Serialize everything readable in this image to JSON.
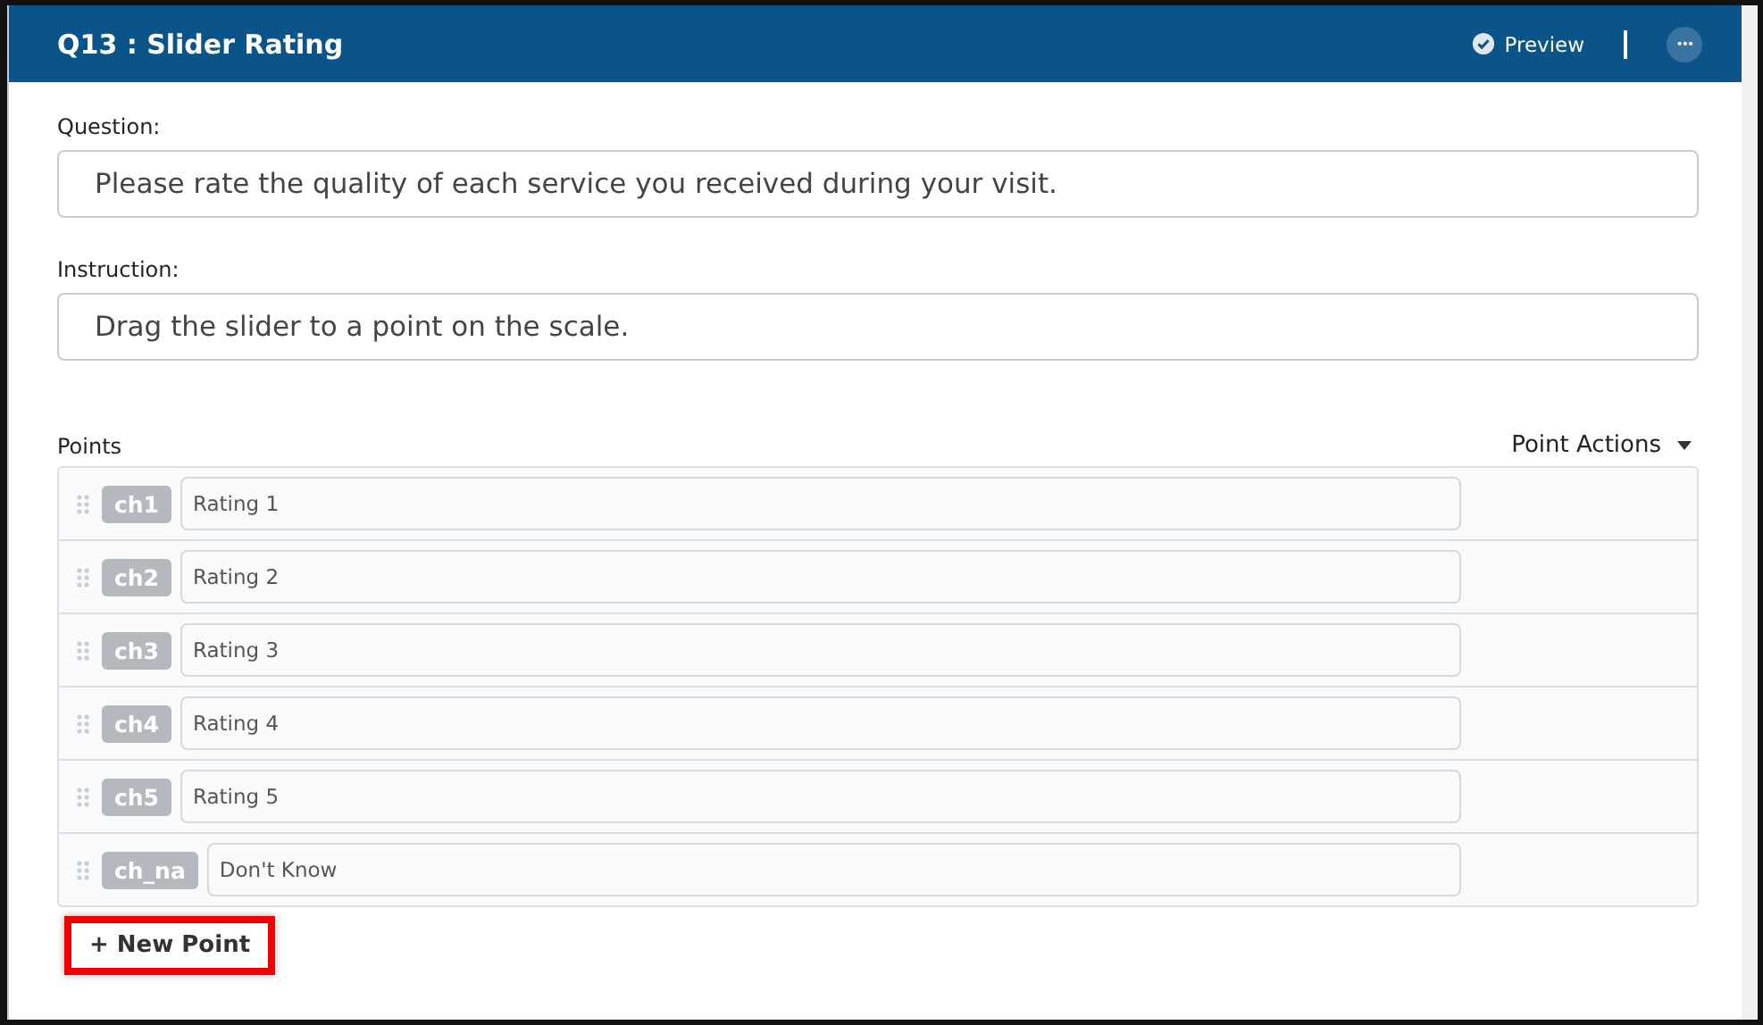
{
  "header": {
    "title": "Q13 : Slider Rating",
    "preview": "Preview",
    "more": "•••"
  },
  "question": {
    "label": "Question:",
    "value": "Please rate the quality of each service you received during your visit."
  },
  "instruction": {
    "label": "Instruction:",
    "value": "Drag the slider to a point on the scale."
  },
  "points": {
    "label": "Points",
    "actions": "Point Actions",
    "items": [
      {
        "code": "ch1",
        "value": "Rating 1"
      },
      {
        "code": "ch2",
        "value": "Rating 2"
      },
      {
        "code": "ch3",
        "value": "Rating 3"
      },
      {
        "code": "ch4",
        "value": "Rating 4"
      },
      {
        "code": "ch5",
        "value": "Rating 5"
      },
      {
        "code": "ch_na",
        "value": "Don't Know"
      }
    ]
  },
  "new_point": "+ New Point"
}
